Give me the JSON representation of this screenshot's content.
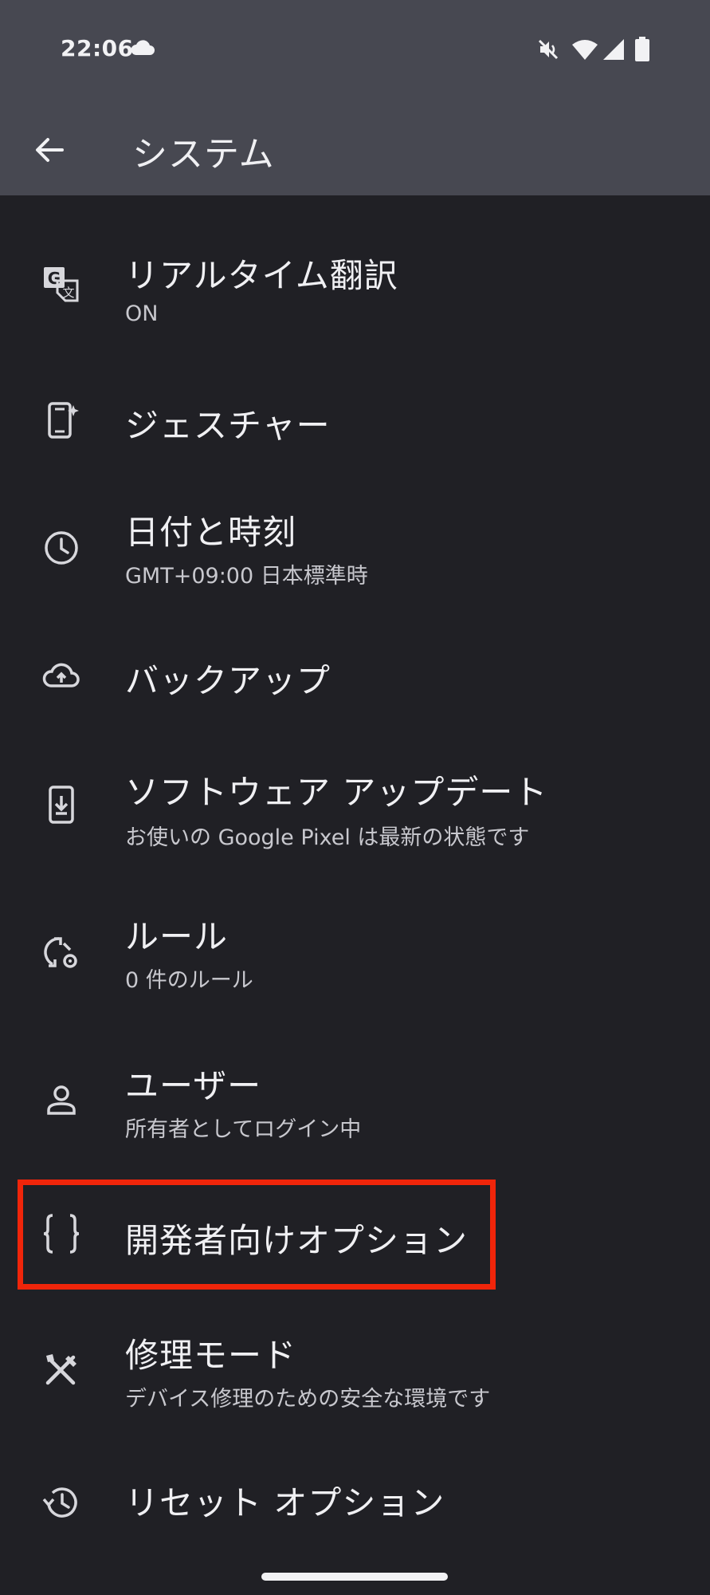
{
  "status_bar": {
    "time": "22:06"
  },
  "header": {
    "title": "システム"
  },
  "items": [
    {
      "title": "リアルタイム翻訳",
      "subtitle": "ON",
      "icon": "translate-icon"
    },
    {
      "title": "ジェスチャー",
      "subtitle": "",
      "icon": "gesture-phone-icon"
    },
    {
      "title": "日付と時刻",
      "subtitle": "GMT+09:00 日本標準時",
      "icon": "clock-icon"
    },
    {
      "title": "バックアップ",
      "subtitle": "",
      "icon": "cloud-upload-icon"
    },
    {
      "title": "ソフトウェア アップデート",
      "subtitle": "お使いの Google Pixel は最新の状態です",
      "icon": "system-update-icon"
    },
    {
      "title": "ルール",
      "subtitle": "0 件のルール",
      "icon": "rules-icon"
    },
    {
      "title": "ユーザー",
      "subtitle": "所有者としてログイン中",
      "icon": "person-icon"
    },
    {
      "title": "開発者向けオプション",
      "subtitle": "",
      "icon": "code-braces-icon"
    },
    {
      "title": "修理モード",
      "subtitle": "デバイス修理のための安全な環境です",
      "icon": "repair-tools-icon"
    },
    {
      "title": "リセット オプション",
      "subtitle": "",
      "icon": "history-icon"
    }
  ],
  "colors": {
    "header_bg": "#474851",
    "page_bg": "#202025",
    "highlight": "#f0250a"
  }
}
